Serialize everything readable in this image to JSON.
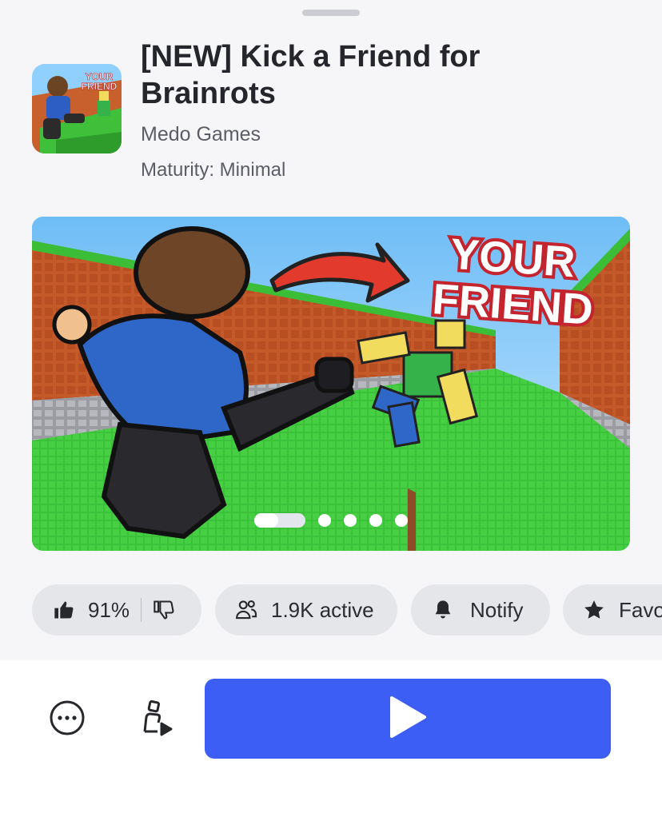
{
  "game": {
    "title": "[NEW] Kick a Friend for Brainrots",
    "creator": "Medo Games",
    "maturity": "Maturity: Minimal",
    "icon_text": "YOUR FRIEND"
  },
  "carousel": {
    "overlay_text_1": "YOUR",
    "overlay_text_2": "FRIEND",
    "slide_count": 5,
    "active_index": 0
  },
  "stats": {
    "rating": "91%",
    "active_players": "1.9K active",
    "notify_label": "Notify",
    "favorite_label": "Favo"
  },
  "colors": {
    "play_button": "#3c5ef5",
    "pill_bg": "#e5e6ea",
    "page_bg": "#f6f6f8"
  }
}
